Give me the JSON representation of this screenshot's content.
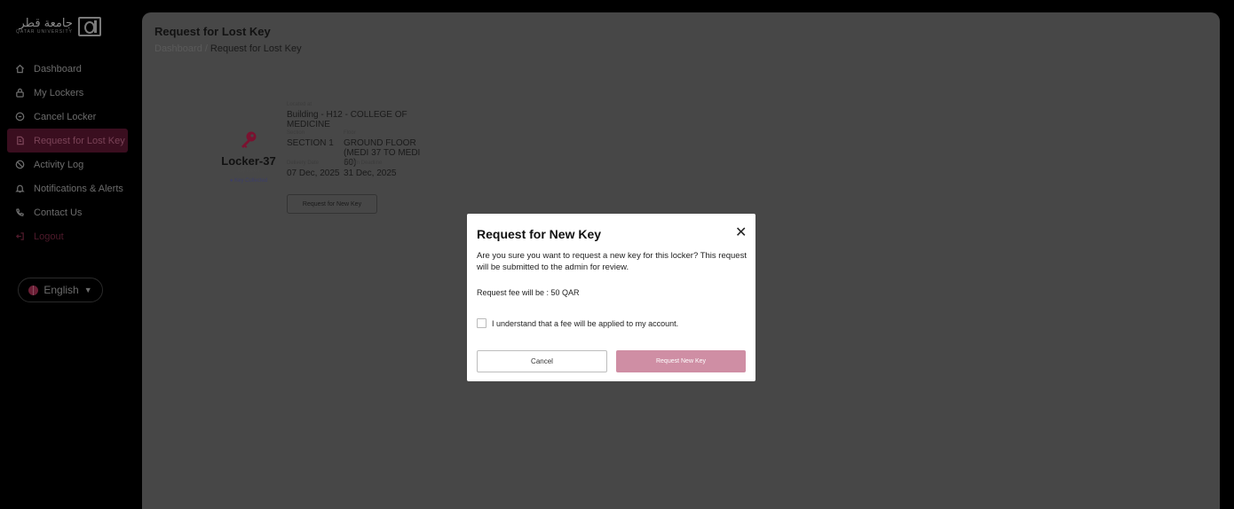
{
  "brand": {
    "name_ar": "جامعة قطر",
    "name_en": "QATAR UNIVERSITY"
  },
  "sidebar": {
    "items": [
      {
        "label": "Dashboard",
        "icon": "home-icon"
      },
      {
        "label": "My Lockers",
        "icon": "lock-icon"
      },
      {
        "label": "Cancel Locker",
        "icon": "cancel-circle-icon"
      },
      {
        "label": "Request for Lost Key",
        "icon": "key-request-icon"
      },
      {
        "label": "Activity Log",
        "icon": "activity-icon"
      },
      {
        "label": "Notifications & Alerts",
        "icon": "bell-icon"
      },
      {
        "label": "Contact Us",
        "icon": "phone-icon"
      },
      {
        "label": "Logout",
        "icon": "logout-icon"
      }
    ],
    "language": "English"
  },
  "page": {
    "title": "Request for Lost Key",
    "breadcrumb": {
      "root": "Dashboard",
      "separator": "/",
      "current": "Request for Lost Key"
    }
  },
  "locker": {
    "name": "Locker-37",
    "type": "Key Locker",
    "status": "● Key Collected",
    "located_label": "Located at",
    "location": "Building - H12 - COLLEGE OF MEDICINE",
    "section_label": "Section",
    "section": "SECTION 1",
    "floor_label": "Floor",
    "floor": "GROUND FLOOR (MEDI 37 TO MEDI 60)",
    "delivery_label": "Delivery Date",
    "delivery": "07 Dec, 2025",
    "return_label": "Return Deadline",
    "return": "31 Dec, 2025",
    "request_button": "Request for New Key"
  },
  "modal": {
    "title": "Request for New Key",
    "close": "✕",
    "message": "Are you sure you want to request a new key for this locker? This request will be submitted to the admin for review.",
    "fee": "Request fee will be : 50 QAR",
    "checkbox_label": "I understand that a fee will be applied to my account.",
    "cancel": "Cancel",
    "submit": "Request New Key"
  },
  "colors": {
    "accent": "#cf8ea4",
    "active_nav": "#3a0e1f",
    "overlay": "#474747",
    "key": "#7a1230"
  }
}
